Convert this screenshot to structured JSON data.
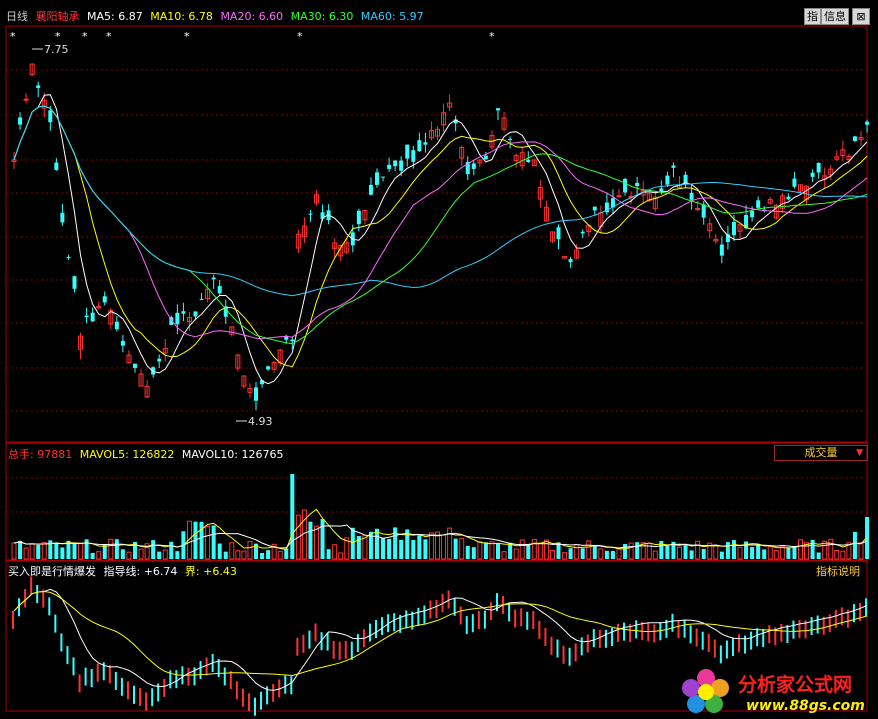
{
  "header": {
    "period": "日线",
    "stock_name": "襄阳轴承",
    "ma": [
      {
        "label": "MA5: 6.87",
        "color": "#ffffff"
      },
      {
        "label": "MA10: 6.78",
        "color": "#ffff00"
      },
      {
        "label": "MA20: 6.60",
        "color": "#ff66ff"
      },
      {
        "label": "MA30: 6.30",
        "color": "#33ff33"
      },
      {
        "label": "MA60: 5.97",
        "color": "#33ccff"
      }
    ],
    "buttons": {
      "zhi": "指",
      "info": "信息",
      "close": "⊠"
    }
  },
  "price_panel": {
    "high_label": "7.75",
    "low_label": "4.93"
  },
  "volume_panel": {
    "total_label": "总手: 97881",
    "mavol5": "MAVOL5: 126822",
    "mavol10": "MAVOL10: 126765",
    "selector": "成交量"
  },
  "indicator_panel": {
    "name": "买入即是行情爆发",
    "guide": "指导线: +6.74",
    "bound": "界: +6.43",
    "help": "指标说明"
  },
  "watermark": {
    "title": "分析家公式网",
    "url": "www.88gs.com"
  },
  "colors": {
    "up": "#ff3333",
    "down": "#33ffff",
    "grid": "#8a0000",
    "border": "#b00000"
  }
}
